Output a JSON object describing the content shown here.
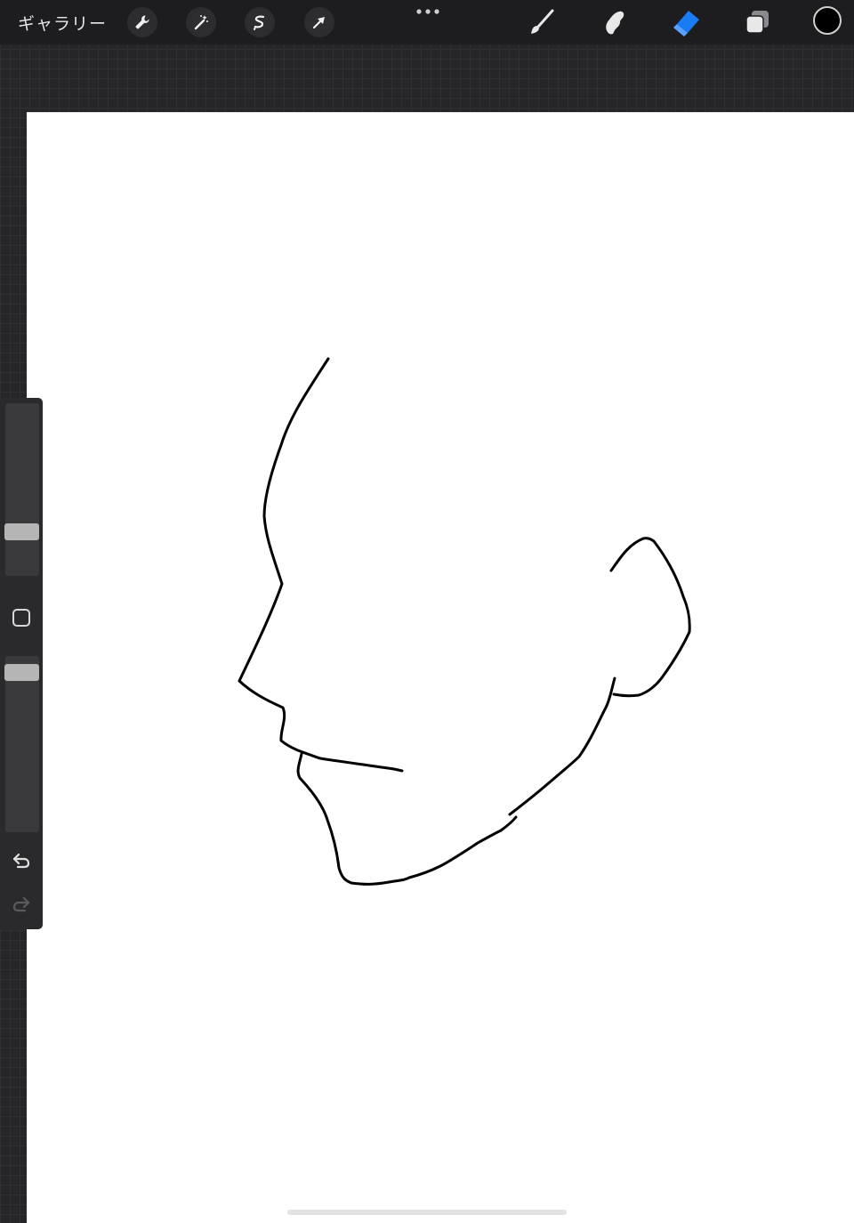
{
  "toolbar": {
    "gallery_label": "ギャラリー",
    "left_tools": [
      "wrench-icon",
      "magic-wand-icon",
      "selection-icon",
      "transform-arrow-icon"
    ],
    "more_icon": "more-dots-icon",
    "right_tools": [
      "brush-icon",
      "smudge-icon",
      "eraser-icon",
      "layers-icon"
    ],
    "active_tool": "eraser-icon",
    "active_color": "#000000",
    "accent_color": "#1a7cf5"
  },
  "sidebar": {
    "brush_size_level": 0.23,
    "brush_opacity_level": 0.95,
    "modify_icon": "square-modify-icon",
    "undo_icon": "undo-arrow-icon",
    "redo_icon": "redo-arrow-icon",
    "redo_enabled": false
  }
}
